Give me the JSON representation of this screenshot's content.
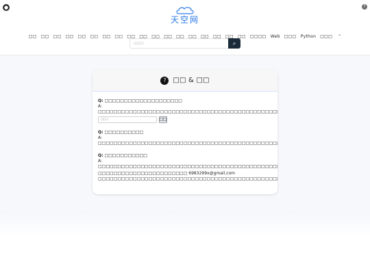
{
  "header": {
    "logo_text": "天空网"
  },
  "nav": {
    "items": [
      "□□",
      "□□",
      "□□",
      "□□",
      "□□",
      "□□",
      "□□",
      "□□",
      "□□",
      "□□",
      "□□",
      "□□",
      "□□",
      "□□",
      "□□",
      "□□",
      "□□",
      "□□",
      "□□□□",
      "Web",
      "□□□",
      "Python",
      "□□□"
    ]
  },
  "search": {
    "placeholder": "□□□□"
  },
  "card": {
    "title": "□□ & □□",
    "qas": [
      {
        "q": "Q: □□□□□□□□□□□□□□□□□□□□",
        "a": "A: □□□□□□□□□□□□□□□□□□□□□□□□□□□□□□□□□□□□□□□□□□□□□□□□□□□□□",
        "input_placeholder": "□□□",
        "button_label": "□□"
      },
      {
        "q": "Q: □□□□□□□□□□",
        "a": "A: □□□□□□□□□□□□□□□□□□□□□□□□□□□□□□□□□□□□□□□□□□□□□□□□□□□□□□□□□□□□□□□□□□□□□□□□"
      },
      {
        "q": "Q: □□□□□□□□□□□",
        "a": "A: □□□□□□□□□□□□□□□□□□□□□□□□□□□□□□□□□□□□□□□□□□□□□□□□□□□□□□□□□□□□□□□□□□□□□□□□□□□□□□□□□□□□□□□□□□□",
        "email_line_prefix": "□□□□□□□□□□□□□□□□□□□□□□□ ",
        "email": "6983299x@gmail.com",
        "email_line_suffix": " □□□□□□□□□□□□□□□□□□□□□□□□□□□□□□□□□□□□□□□□□□□□□□□"
      }
    ]
  }
}
